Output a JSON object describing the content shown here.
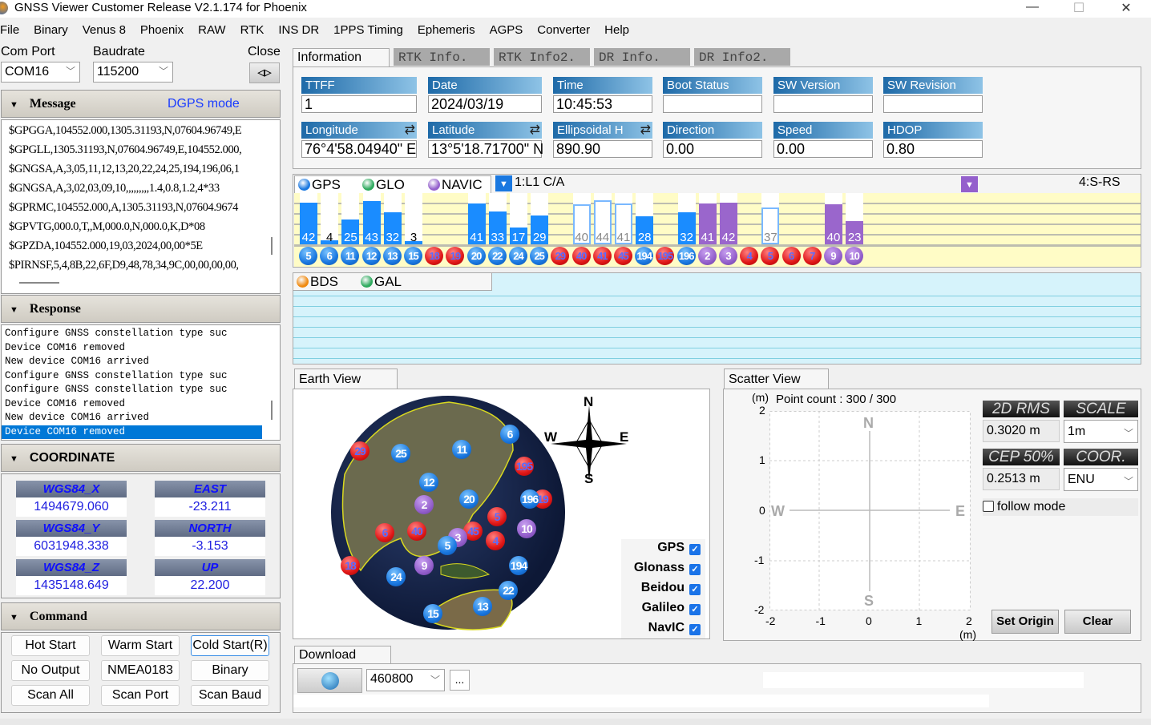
{
  "window": {
    "title": "GNSS Viewer Customer Release V2.1.174 for Phoenix",
    "min": "—",
    "max": "☐",
    "close": "✕"
  },
  "menu": [
    "File",
    "Binary",
    "Venus 8",
    "Phoenix",
    "RAW",
    "RTK",
    "INS DR",
    "1PPS Timing",
    "Ephemeris",
    "AGPS",
    "Converter",
    "Help"
  ],
  "connection": {
    "com_port_label": "Com Port",
    "com_port": "COM16",
    "baudrate_label": "Baudrate",
    "baudrate": "115200",
    "close_label": "Close",
    "close_icon": "disconnect-plug-icon"
  },
  "message": {
    "title": "Message",
    "mode": "DGPS mode",
    "lines": [
      "$GPGGA,104552.000,1305.31193,N,07604.96749,E",
      "$GPGLL,1305.31193,N,07604.96749,E,104552.000,",
      "$GNGSA,A,3,05,11,12,13,20,22,24,25,194,196,06,1",
      "$GNGSA,A,3,02,03,09,10,,,,,,,,,1.4,0.8,1.2,4*33",
      "$GPRMC,104552.000,A,1305.31193,N,07604.9674",
      "$GPVTG,000.0,T,,M,000.0,N,000.0,K,D*08",
      "$GPZDA,104552.000,19,03,2024,00,00*5E",
      "$PIRNSF,5,4,8B,22,6F,D9,48,78,34,9C,00,00,00,00,"
    ]
  },
  "response": {
    "title": "Response",
    "lines": [
      "Configure GNSS constellation type suc",
      "Device COM16 removed",
      "New device COM16 arrived",
      "Configure GNSS constellation type suc",
      "Configure GNSS constellation type suc",
      "Device COM16 removed",
      "New device COM16 arrived",
      "Device COM16 removed"
    ],
    "selected_index": 7
  },
  "coordinate": {
    "title": "COORDINATE",
    "fields": [
      {
        "label": "WGS84_X",
        "value": "1494679.060"
      },
      {
        "label": "EAST",
        "value": "-23.211"
      },
      {
        "label": "WGS84_Y",
        "value": "6031948.338"
      },
      {
        "label": "NORTH",
        "value": "-3.153"
      },
      {
        "label": "WGS84_Z",
        "value": "1435148.649"
      },
      {
        "label": "UP",
        "value": "22.200"
      }
    ]
  },
  "command": {
    "title": "Command",
    "buttons": [
      "Hot Start",
      "Warm Start",
      "Cold Start(R)",
      "No Output",
      "NMEA0183",
      "Binary",
      "Scan All",
      "Scan Port",
      "Scan Baud"
    ]
  },
  "tabs": [
    "Information",
    "RTK Info.",
    "RTK Info2.",
    "DR Info.",
    "DR Info2."
  ],
  "info": {
    "row1": [
      {
        "label": "TTFF",
        "value": "1"
      },
      {
        "label": "Date",
        "value": "2024/03/19"
      },
      {
        "label": "Time",
        "value": "10:45:53"
      },
      {
        "label": "Boot  Status",
        "value": ""
      },
      {
        "label": "SW  Version",
        "value": ""
      },
      {
        "label": "SW  Revision",
        "value": ""
      }
    ],
    "row2": [
      {
        "label": "Longitude",
        "value": "76°4'58.04940\" E"
      },
      {
        "label": "Latitude",
        "value": "13°5'18.71700\" N"
      },
      {
        "label": "Ellipsoidal H",
        "value": "890.90"
      },
      {
        "label": "Direction",
        "value": "0.00"
      },
      {
        "label": "Speed",
        "value": "0.00"
      },
      {
        "label": "HDOP",
        "value": "0.80"
      }
    ]
  },
  "sat_panel": {
    "legend": [
      {
        "name": "GPS",
        "color": "#1a78e0"
      },
      {
        "name": "GLO",
        "color": "#2eaa5e"
      },
      {
        "name": "NAVIC",
        "color": "#9460cc"
      }
    ],
    "signal_left": "1:L1 C/A",
    "signal_right": "4:S-RS",
    "satellites": [
      {
        "prn": "5",
        "sys": "blue",
        "snr": 42,
        "state": "used"
      },
      {
        "prn": "6",
        "sys": "blue",
        "snr": 4,
        "state": "used"
      },
      {
        "prn": "11",
        "sys": "blue",
        "snr": 25,
        "state": "used"
      },
      {
        "prn": "12",
        "sys": "blue",
        "snr": 43,
        "state": "used"
      },
      {
        "prn": "13",
        "sys": "blue",
        "snr": 32,
        "state": "used"
      },
      {
        "prn": "15",
        "sys": "blue",
        "snr": 3,
        "state": "used"
      },
      {
        "prn": "18",
        "sys": "red",
        "snr": null,
        "state": "none"
      },
      {
        "prn": "19",
        "sys": "red",
        "snr": null,
        "state": "none"
      },
      {
        "prn": "20",
        "sys": "blue",
        "snr": 41,
        "state": "used"
      },
      {
        "prn": "22",
        "sys": "blue",
        "snr": 33,
        "state": "used"
      },
      {
        "prn": "24",
        "sys": "blue",
        "snr": 17,
        "state": "used"
      },
      {
        "prn": "25",
        "sys": "blue",
        "snr": 29,
        "state": "used"
      },
      {
        "prn": "29",
        "sys": "red",
        "snr": null,
        "state": "none"
      },
      {
        "prn": "40",
        "sys": "red",
        "snr": 40,
        "state": "tracked"
      },
      {
        "prn": "41",
        "sys": "red",
        "snr": 44,
        "state": "tracked"
      },
      {
        "prn": "45",
        "sys": "red",
        "snr": 41,
        "state": "tracked"
      },
      {
        "prn": "194",
        "sys": "blue",
        "snr": 28,
        "state": "used"
      },
      {
        "prn": "195",
        "sys": "red",
        "snr": null,
        "state": "none"
      },
      {
        "prn": "196",
        "sys": "blue",
        "snr": 32,
        "state": "used"
      },
      {
        "prn": "2",
        "sys": "purple",
        "snr": 41,
        "state": "used"
      },
      {
        "prn": "3",
        "sys": "purple",
        "snr": 42,
        "state": "used"
      },
      {
        "prn": "4",
        "sys": "red",
        "snr": null,
        "state": "none"
      },
      {
        "prn": "5",
        "sys": "red",
        "snr": 37,
        "state": "tracked"
      },
      {
        "prn": "6",
        "sys": "red",
        "snr": null,
        "state": "none"
      },
      {
        "prn": "7",
        "sys": "red",
        "snr": null,
        "state": "none"
      },
      {
        "prn": "9",
        "sys": "purple",
        "snr": 40,
        "state": "used"
      },
      {
        "prn": "10",
        "sys": "purple",
        "snr": 23,
        "state": "used"
      }
    ]
  },
  "sat_panel2": {
    "legend": [
      {
        "name": "BDS",
        "color": "#f08a10"
      },
      {
        "name": "GAL",
        "color": "#2eaa5e"
      }
    ]
  },
  "earth_view": {
    "title": "Earth View",
    "compass": {
      "n": "N",
      "s": "S",
      "e": "E",
      "w": "W"
    },
    "sats": [
      {
        "prn": "29",
        "c": "red",
        "x": 449,
        "y": 563
      },
      {
        "prn": "25",
        "c": "blue",
        "x": 500,
        "y": 566
      },
      {
        "prn": "11",
        "c": "blue",
        "x": 576,
        "y": 561
      },
      {
        "prn": "6",
        "c": "blue",
        "x": 636,
        "y": 542
      },
      {
        "prn": "195",
        "c": "red",
        "x": 654,
        "y": 582
      },
      {
        "prn": "12",
        "c": "blue",
        "x": 535,
        "y": 602
      },
      {
        "prn": "2",
        "c": "purple",
        "x": 529,
        "y": 630
      },
      {
        "prn": "20",
        "c": "blue",
        "x": 585,
        "y": 623
      },
      {
        "prn": "19",
        "c": "red",
        "x": 677,
        "y": 623
      },
      {
        "prn": "196",
        "c": "blue",
        "x": 661,
        "y": 623
      },
      {
        "prn": "5",
        "c": "red",
        "x": 620,
        "y": 645
      },
      {
        "prn": "10",
        "c": "purple",
        "x": 657,
        "y": 660
      },
      {
        "prn": "6",
        "c": "red",
        "x": 480,
        "y": 665
      },
      {
        "prn": "40",
        "c": "red",
        "x": 520,
        "y": 663
      },
      {
        "prn": "45",
        "c": "red",
        "x": 590,
        "y": 663
      },
      {
        "prn": "3",
        "c": "purple",
        "x": 571,
        "y": 671
      },
      {
        "prn": "5",
        "c": "blue",
        "x": 558,
        "y": 681
      },
      {
        "prn": "4",
        "c": "red",
        "x": 618,
        "y": 675
      },
      {
        "prn": "18",
        "c": "red",
        "x": 437,
        "y": 706
      },
      {
        "prn": "9",
        "c": "purple",
        "x": 529,
        "y": 706
      },
      {
        "prn": "194",
        "c": "blue",
        "x": 647,
        "y": 706
      },
      {
        "prn": "24",
        "c": "blue",
        "x": 494,
        "y": 720
      },
      {
        "prn": "22",
        "c": "blue",
        "x": 634,
        "y": 737
      },
      {
        "prn": "13",
        "c": "blue",
        "x": 602,
        "y": 757
      },
      {
        "prn": "15",
        "c": "blue",
        "x": 540,
        "y": 766
      }
    ],
    "filters": [
      {
        "name": "GPS",
        "checked": true
      },
      {
        "name": "Glonass",
        "checked": true
      },
      {
        "name": "Beidou",
        "checked": true
      },
      {
        "name": "Galileo",
        "checked": true
      },
      {
        "name": "NavIC",
        "checked": true
      }
    ]
  },
  "scatter_view": {
    "title": "Scatter View",
    "unit": "(m)",
    "point_count": "Point count : 300 / 300",
    "x_ticks": [
      "-2",
      "-1",
      "0",
      "1",
      "2"
    ],
    "y_ticks": [
      "2",
      "1",
      "0",
      "-1",
      "-2"
    ],
    "dirs": {
      "n": "N",
      "s": "S",
      "e": "E",
      "w": "W"
    },
    "rms_label": "2D RMS",
    "rms_value": "0.3020 m",
    "scale_label": "SCALE",
    "scale_value": "1m",
    "cep_label": "CEP 50%",
    "cep_value": "0.2513 m",
    "coor_label": "COOR.",
    "coor_value": "ENU",
    "follow_mode": "follow mode",
    "follow_checked": false,
    "set_origin": "Set Origin",
    "clear": "Clear"
  },
  "download": {
    "title": "Download",
    "baud": "460800",
    "browse": "..."
  }
}
